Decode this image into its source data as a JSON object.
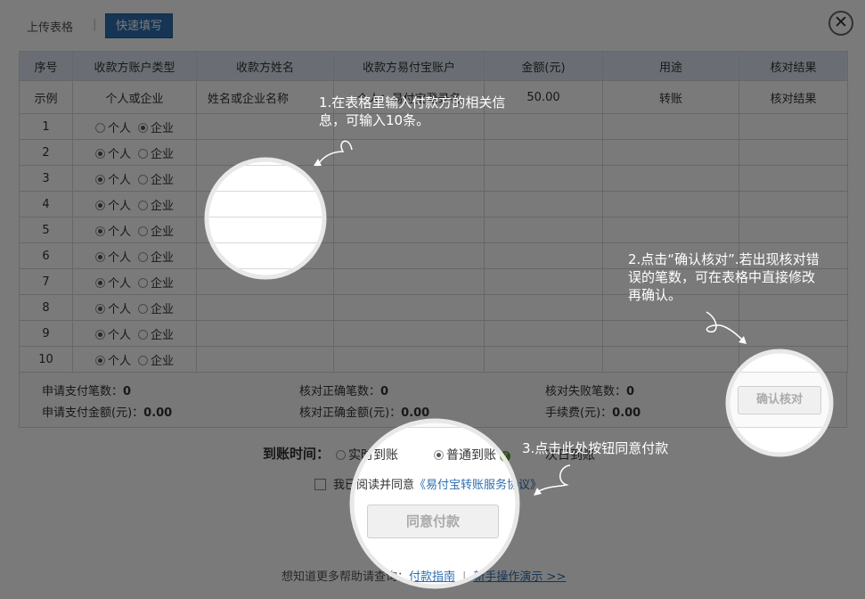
{
  "tabs": {
    "upload": "上传表格",
    "quick": "快速填写"
  },
  "close_label": "✕",
  "table": {
    "headers": [
      "序号",
      "收款方账户类型",
      "收款方姓名",
      "收款方易付宝账户",
      "金额(元)",
      "用途",
      "核对结果"
    ],
    "example": {
      "index": "示例",
      "type": "个人或企业",
      "name": "姓名或企业名称",
      "account": "个人：易付宝登录名",
      "amount": "50.00",
      "purpose": "转账",
      "result": "核对结果"
    },
    "option_personal": "个人",
    "option_enterprise": "企业",
    "rows": [
      "1",
      "2",
      "3",
      "4",
      "5",
      "6",
      "7",
      "8",
      "9",
      "10"
    ]
  },
  "summary": {
    "apply_count_label": "申请支付笔数：",
    "apply_count": "0",
    "apply_amount_label": "申请支付金额(元)：",
    "apply_amount": "0.00",
    "ok_count_label": "核对正确笔数：",
    "ok_count": "0",
    "ok_amount_label": "核对正确金额(元)：",
    "ok_amount": "0.00",
    "fail_count_label": "核对失败笔数：",
    "fail_count": "0",
    "fee_label": "手续费(元)：",
    "fee": "0.00"
  },
  "confirm_button": "确认核对",
  "arrival": {
    "label": "到账时间：",
    "realtime": "实时到账",
    "normal": "普通到账",
    "nextday": "次日到账",
    "selected": "normal"
  },
  "agree": {
    "text": "我已阅读并同意",
    "link": "《易付宝转账服务协议》"
  },
  "pay_button": "同意付款",
  "footer": {
    "text": "想知道更多帮助请查询：",
    "guide": "付款指南",
    "demo": "新手操作演示 >>"
  },
  "tips": {
    "tip1": "1.在表格里输入付款方的相关信息，可输入10条。",
    "tip2": "2.点击“确认核对”.若出现核对错误的笔数，可在表格中直接修改再确认。",
    "tip3": "3.点击此处按钮同意付款"
  },
  "colors": {
    "accent": "#2e6fb0",
    "overlay": "rgba(0,0,0,0.52)"
  }
}
